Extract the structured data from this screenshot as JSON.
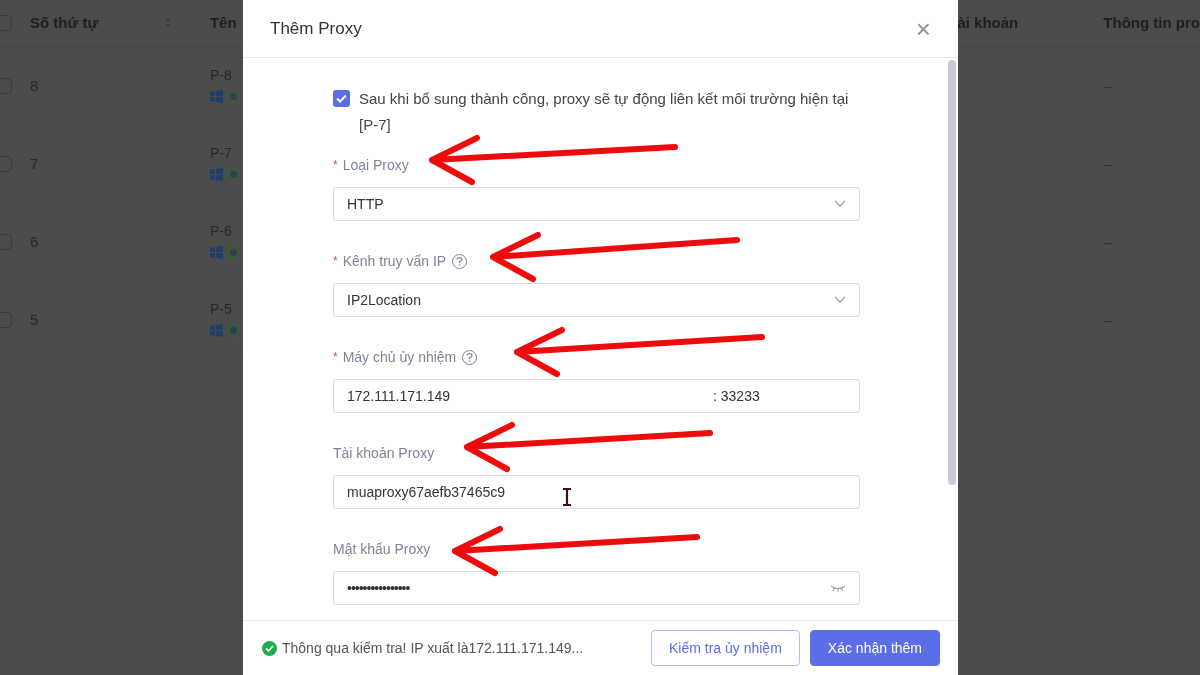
{
  "table": {
    "header_checked": false,
    "columns": [
      {
        "label": "Số thứ tự",
        "sortable": true
      },
      {
        "label": "Tên",
        "sortable": false
      },
      {
        "label": "ài khoản",
        "sortable": false
      },
      {
        "label": "Thông tin pro",
        "sortable": false
      }
    ],
    "rows": [
      {
        "checked": false,
        "index": "8",
        "name": "P-8",
        "proxy_info": "--"
      },
      {
        "checked": false,
        "index": "7",
        "name": "P-7",
        "proxy_info": "--"
      },
      {
        "checked": false,
        "index": "6",
        "name": "P-6",
        "proxy_info": "--"
      },
      {
        "checked": false,
        "index": "5",
        "name": "P-5",
        "proxy_info": "--"
      }
    ]
  },
  "dialog": {
    "title": "Thêm Proxy",
    "close": "×",
    "checkbox": {
      "checked": true,
      "label": "Sau khi bổ sung thành công, proxy sẽ tự động liên kết môi trường hiện tại [P-7]"
    },
    "fields": [
      {
        "kind": "select",
        "required_mark": "*",
        "label": "Loại Proxy",
        "help": false,
        "value": "HTTP"
      },
      {
        "kind": "select",
        "required_mark": "*",
        "label": "Kênh truy vấn IP",
        "help": true,
        "value": "IP2Location"
      },
      {
        "kind": "host_port",
        "required_mark": "*",
        "label": "Máy chủ ủy nhiệm",
        "help": true,
        "value": "172.111.171.149",
        "port": ": 33233"
      },
      {
        "kind": "text",
        "label": "Tài khoản Proxy",
        "help": false,
        "value": "muaproxy67aefb37465c9"
      },
      {
        "kind": "password",
        "label": "Mật khẩu Proxy",
        "help": false,
        "value": "••••••••••••••••"
      }
    ],
    "status": "Thông qua kiểm tra! IP xuất là172.111.171.149...",
    "buttons": [
      {
        "label": "Kiểm tra ủy nhiệm",
        "kind": "secondary"
      },
      {
        "label": "Xác nhận thêm",
        "kind": "primary"
      }
    ]
  }
}
